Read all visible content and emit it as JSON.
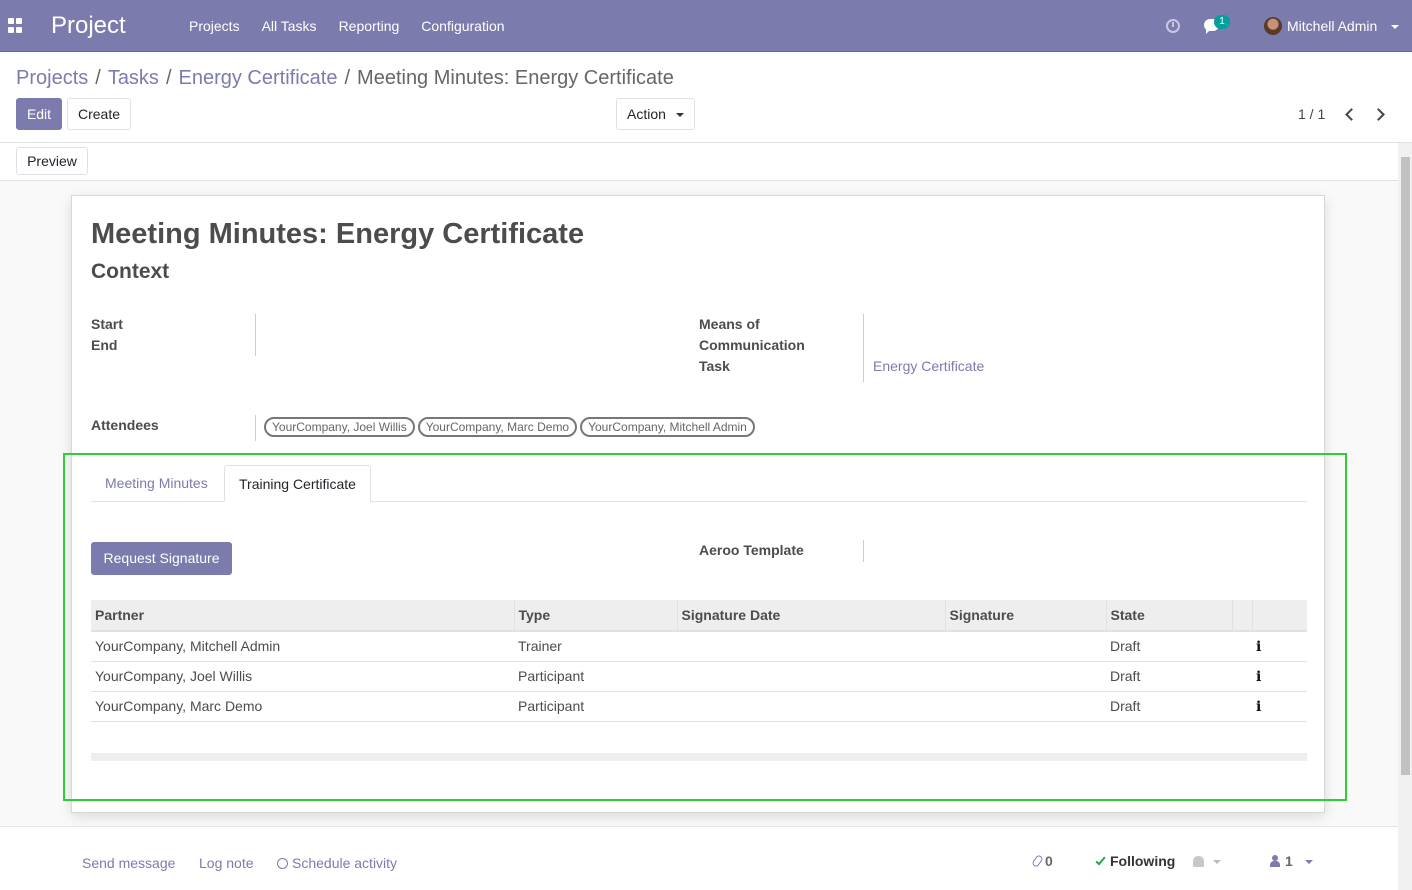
{
  "navbar": {
    "app_title": "Project",
    "menu": [
      "Projects",
      "All Tasks",
      "Reporting",
      "Configuration"
    ],
    "chat_badge": "1",
    "user_name": "Mitchell Admin",
    "colors": {
      "bar": "#7c7bad",
      "badge": "#00a09d"
    }
  },
  "control_panel": {
    "breadcrumb": [
      "Projects",
      "Tasks",
      "Energy Certificate",
      "Meeting Minutes: Energy Certificate"
    ],
    "edit_label": "Edit",
    "create_label": "Create",
    "action_label": "Action",
    "pager": "1 / 1"
  },
  "statusbar": {
    "preview_label": "Preview"
  },
  "form": {
    "title": "Meeting Minutes: Energy Certificate",
    "subtitle": "Context",
    "start_label": "Start",
    "end_label": "End",
    "means_label_1": "Means of",
    "means_label_2": "Communication",
    "task_label": "Task",
    "task_value": "Energy Certificate",
    "attendees_label": "Attendees",
    "attendees": [
      "YourCompany, Joel Willis",
      "YourCompany, Marc Demo",
      "YourCompany, Mitchell Admin"
    ],
    "tabs": [
      "Meeting Minutes",
      "Training Certificate"
    ],
    "active_tab": "Training Certificate",
    "request_signature_label": "Request Signature",
    "aeroo_label": "Aeroo Template"
  },
  "signature_table": {
    "headers": [
      "Partner",
      "Type",
      "Signature Date",
      "Signature",
      "State"
    ],
    "rows": [
      {
        "partner": "YourCompany, Mitchell Admin",
        "type": "Trainer",
        "date": "",
        "signature": "",
        "state": "Draft"
      },
      {
        "partner": "YourCompany, Joel Willis",
        "type": "Participant",
        "date": "",
        "signature": "",
        "state": "Draft"
      },
      {
        "partner": "YourCompany, Marc Demo",
        "type": "Participant",
        "date": "",
        "signature": "",
        "state": "Draft"
      }
    ],
    "row_icon": "info-icon",
    "info_glyph": "i"
  },
  "chatter": {
    "send_message": "Send message",
    "log_note": "Log note",
    "schedule_activity": "Schedule activity",
    "attachments": "0",
    "following": "Following",
    "followers": "1"
  },
  "highlight_color": "#33cc33"
}
